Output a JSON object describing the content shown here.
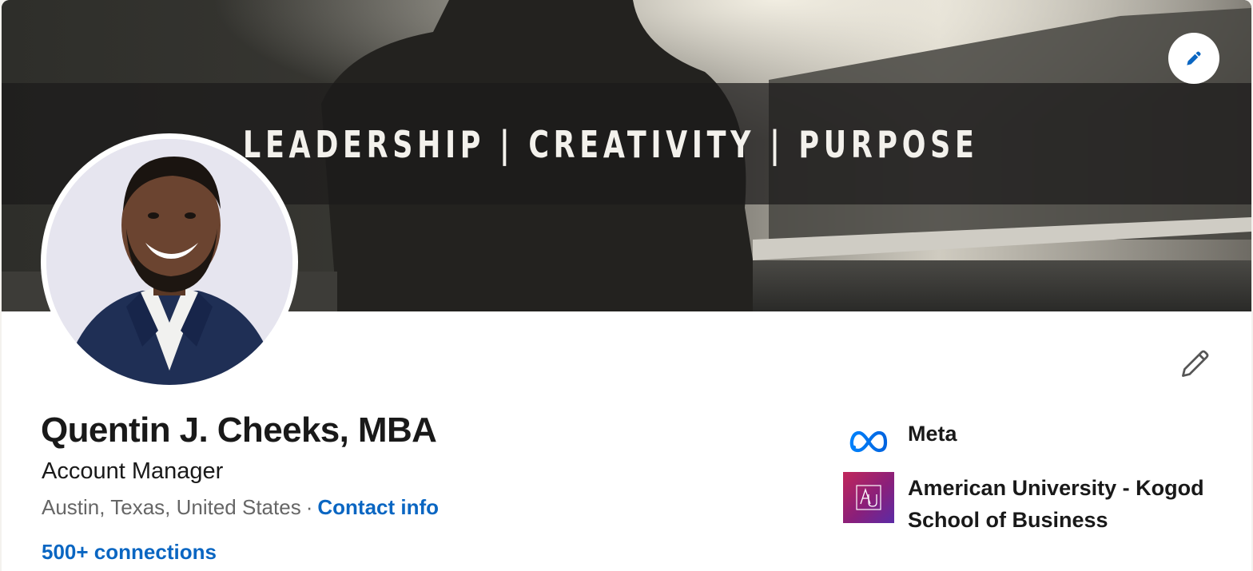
{
  "banner": {
    "text": "LEADERSHIP | CREATIVITY | PURPOSE",
    "edit_icon": "pencil-icon",
    "accent_color": "#0a66c2"
  },
  "profile": {
    "name": "Quentin J. Cheeks, MBA",
    "headline": "Account Manager",
    "location": "Austin, Texas, United States",
    "separator": "·",
    "contact_info_label": "Contact info",
    "connections_label": "500+ connections"
  },
  "intro_edit_icon": "pencil-icon",
  "organizations": [
    {
      "name": "Meta",
      "logo": "meta-logo",
      "brand_color": "#0668e1"
    },
    {
      "name": "American University - Kogod School of Business",
      "logo": "american-university-logo",
      "brand_color": "#8a1a6e"
    }
  ]
}
